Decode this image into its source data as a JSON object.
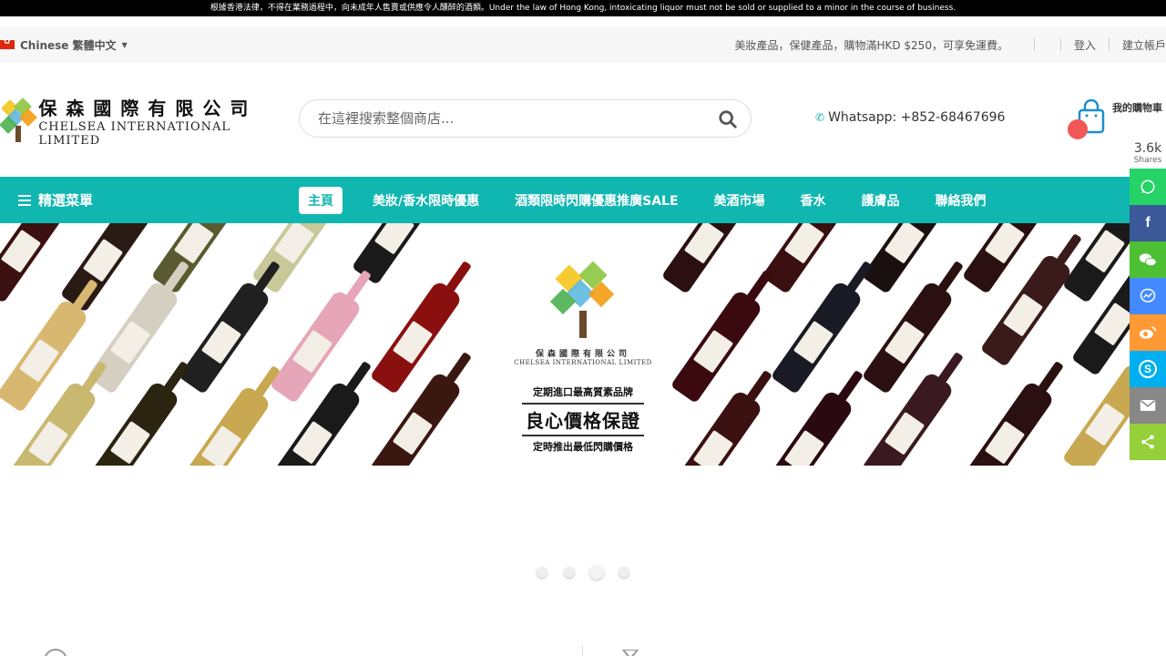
{
  "notice": {
    "text": "根據香港法律，不得在業務過程中，向未成年人售賣或供應令人醺醉的酒類。Under the law of Hong Kong, intoxicating liquor must not be sold or supplied to a minor in the course of business."
  },
  "topbar": {
    "language": "Chinese 繁體中文",
    "promo": "美妝產品，保健產品，購物滿HKD $250，可享免運費。",
    "login": "登入",
    "register": "建立帳戶"
  },
  "header": {
    "logo_cn": "保森國際有限公司",
    "logo_en": "CHELSEA INTERNATIONAL LIMITED",
    "search_placeholder": "在這裡搜索整個商店...",
    "whatsapp": "Whatsapp: +852-68467696",
    "cart_label": "我的購物車"
  },
  "nav": {
    "menu_label": "精選菜單",
    "items": [
      {
        "label": "主頁",
        "active": true
      },
      {
        "label": "美妝/香水限時優惠"
      },
      {
        "label": "酒類限時閃購優惠推廣SALE"
      },
      {
        "label": "美酒市場"
      },
      {
        "label": "香水"
      },
      {
        "label": "護膚品"
      },
      {
        "label": "聯絡我們"
      }
    ]
  },
  "banner": {
    "logo_cn": "保森國際有限公司",
    "logo_en": "CHELSEA INTERNATIONAL LIMITED",
    "line1": "定期進口最高質素品牌",
    "main": "良心價格保證",
    "line2": "定時推出最低閃購價格"
  },
  "slider": {
    "count": 4,
    "active_index": 2
  },
  "share": {
    "count": "3.6k",
    "label": "Shares",
    "buttons": [
      {
        "name": "whatsapp-icon",
        "color": "#25d366"
      },
      {
        "name": "facebook-icon",
        "color": "#3b5998"
      },
      {
        "name": "wechat-icon",
        "color": "#4ec034"
      },
      {
        "name": "messenger-icon",
        "color": "#448aff"
      },
      {
        "name": "weibo-icon",
        "color": "#ff9933"
      },
      {
        "name": "skype-icon",
        "color": "#00aff0"
      },
      {
        "name": "email-icon",
        "color": "#888888"
      },
      {
        "name": "share-icon",
        "color": "#95d03a"
      }
    ]
  },
  "colors": {
    "brand_teal": "#10b6b0",
    "cart_badge": "#f25757"
  }
}
